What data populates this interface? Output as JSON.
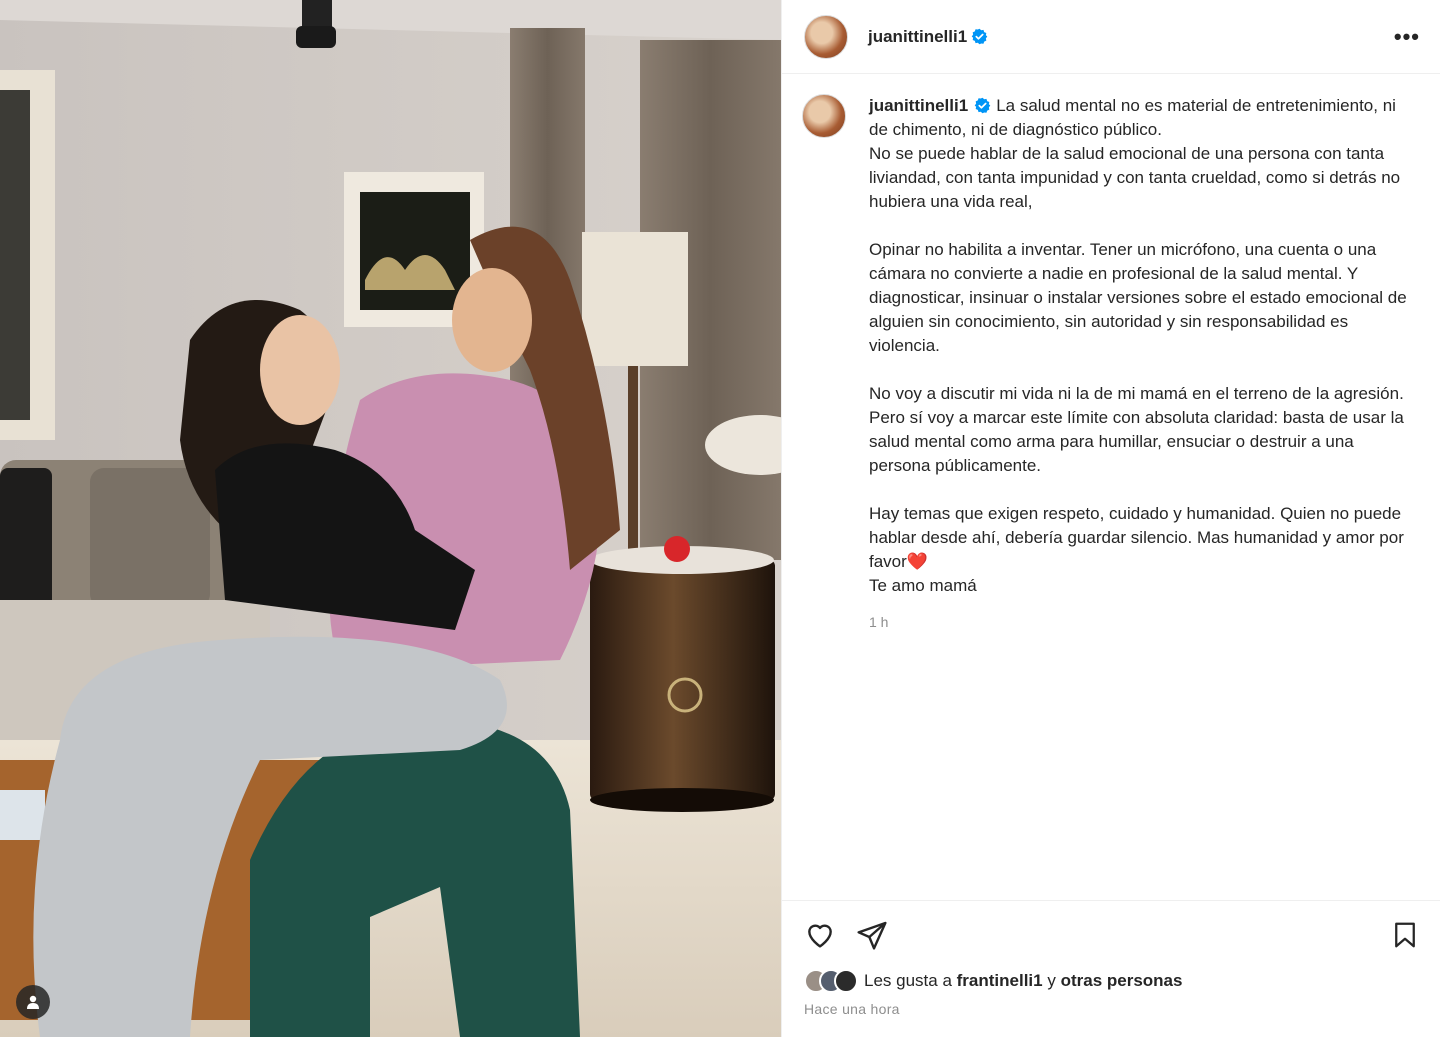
{
  "post": {
    "username": "juanittinelli1",
    "verified": true,
    "more_label": "•••",
    "caption": "La salud mental no es material de entretenimiento, ni de chimento, ni de diagnóstico público. \nNo se puede hablar de la salud emocional de una persona con tanta liviandad, con tanta impunidad y con tanta crueldad, como si detrás no hubiera una vida real,\n\nOpinar no habilita a inventar. Tener un micrófono, una cuenta o una cámara no convierte a nadie en profesional de la salud mental. Y diagnosticar, insinuar o instalar versiones sobre el estado emocional de alguien sin conocimiento, sin autoridad y sin responsabilidad es violencia.\n\nNo voy a discutir mi vida ni la de mi mamá en el terreno de la agresión. Pero sí voy a marcar este límite con absoluta claridad: basta de usar la salud mental como arma para humillar, ensuciar o destruir a una persona públicamente.\n\nHay temas que exigen respeto, cuidado y humanidad. Quien no puede hablar desde ahí, debería guardar silencio. Mas humanidad y amor por favor❤️\nTe amo mamá",
    "caption_time": "1 h",
    "likes": {
      "prefix": "Les gusta a",
      "user": "frantinelli1",
      "connector": "y",
      "others": "otras personas"
    },
    "posted": "Hace una hora"
  },
  "icons": {
    "like": "heart-icon",
    "share": "paper-plane-icon",
    "save": "bookmark-icon",
    "tagged": "person-icon",
    "verified": "verified-badge-icon"
  },
  "colors": {
    "verified_blue": "#0095f6",
    "text": "#262626",
    "muted": "#8e8e8e",
    "border": "#efefef"
  }
}
